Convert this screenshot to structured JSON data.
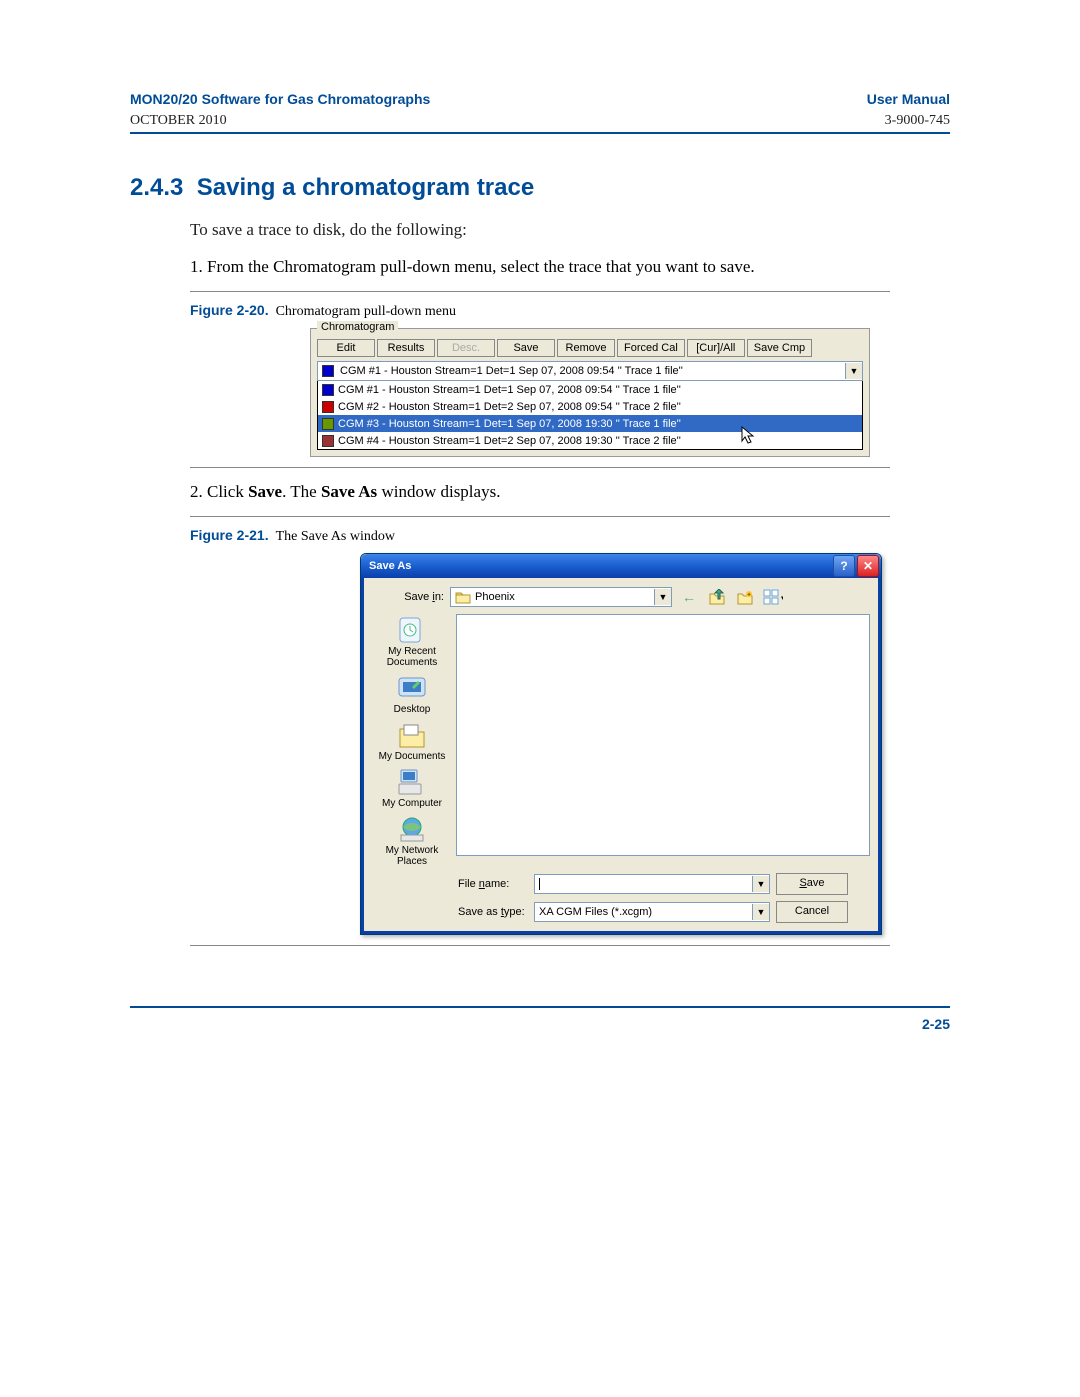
{
  "header": {
    "title": "MON20/20 Software for Gas Chromatographs",
    "date": "OCTOBER 2010",
    "manual": "User Manual",
    "docnum": "3-9000-745"
  },
  "section": {
    "number": "2.4.3",
    "title": "Saving a chromatogram trace"
  },
  "intro": "To save a trace to disk, do the following:",
  "step1": {
    "num": "1.",
    "text": "From the Chromatogram pull-down menu, select the trace that you want to save."
  },
  "fig1": {
    "label": "Figure 2-20.",
    "caption": "Chromatogram pull-down menu"
  },
  "chrom": {
    "group_label": "Chromatogram",
    "buttons": [
      "Edit",
      "Results",
      "Desc.",
      "Save",
      "Remove",
      "Forced Cal",
      "[Cur]/All",
      "Save Cmp"
    ],
    "combo_selected": "CGM #1 - Houston Stream=1 Det=1 Sep 07, 2008 09:54 '' Trace 1 file''",
    "options": [
      {
        "color": "blue",
        "text": "CGM #1 - Houston Stream=1 Det=1 Sep 07, 2008 09:54 '' Trace 1 file''",
        "selected": false
      },
      {
        "color": "red",
        "text": "CGM #2 - Houston Stream=1 Det=2 Sep 07, 2008 09:54 '' Trace 2 file''",
        "selected": false
      },
      {
        "color": "green",
        "text": "CGM #3 - Houston Stream=1 Det=1 Sep 07, 2008 19:30 '' Trace 1 file''",
        "selected": true
      },
      {
        "color": "brown",
        "text": "CGM #4 - Houston Stream=1 Det=2 Sep 07, 2008 19:30 '' Trace 2 file''",
        "selected": false
      }
    ]
  },
  "step2": {
    "num": "2.",
    "prefix": "Click ",
    "b1": "Save",
    "mid": ".  The ",
    "b2": "Save As",
    "suffix": " window displays."
  },
  "fig2": {
    "label": "Figure 2-21.",
    "caption": "The Save As window"
  },
  "saveas": {
    "title": "Save As",
    "savein_label": "Save in:",
    "savein_label_u": "i",
    "folder": "Phoenix",
    "places": [
      "My Recent Documents",
      "Desktop",
      "My Documents",
      "My Computer",
      "My Network Places"
    ],
    "filename_label": "File name:",
    "filename_label_u": "n",
    "filename_value": "",
    "type_label": "Save as type:",
    "type_label_u": "t",
    "type_value": "XA CGM Files (*.xcgm)",
    "save_btn": "Save",
    "save_btn_u": "S",
    "cancel_btn": "Cancel"
  },
  "pagenum": "2-25"
}
